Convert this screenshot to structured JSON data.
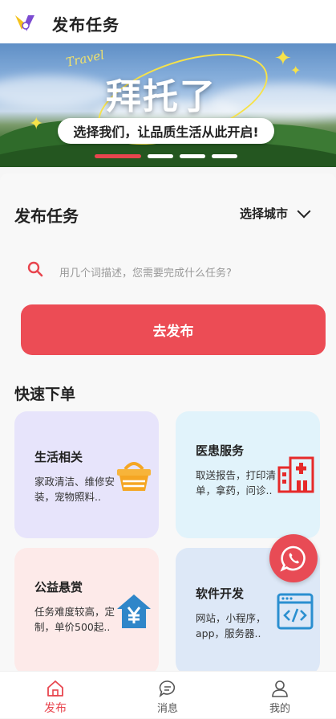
{
  "header": {
    "title": "发布任务"
  },
  "banner": {
    "script_text": "Travel",
    "headline": "拜托了",
    "tagline": "选择我们，让品质生活从此开启!",
    "slides": 4,
    "active_slide": 0
  },
  "publish_section": {
    "title": "发布任务",
    "city_label": "选择城市",
    "search_placeholder": "用几个词描述，您需要完成什么任务?",
    "publish_button": "去发布"
  },
  "quick_order": {
    "title": "快速下单",
    "tiles": [
      {
        "title": "生活相关",
        "desc": "家政清洁、维修安装，宠物照料..",
        "icon": "basket-icon"
      },
      {
        "title": "医患服务",
        "desc": "取送报告，打印清单，拿药，问诊..",
        "icon": "hospital-icon"
      },
      {
        "title": "公益悬赏",
        "desc": "任务难度较高，定制，单价500起..",
        "icon": "house-yen-icon"
      },
      {
        "title": "软件开发",
        "desc": "网站，小程序，app，服务器..",
        "icon": "code-window-icon"
      }
    ]
  },
  "tabbar": {
    "items": [
      {
        "label": "发布",
        "icon": "home-icon",
        "active": true
      },
      {
        "label": "消息",
        "icon": "chat-icon",
        "active": false
      },
      {
        "label": "我的",
        "icon": "user-icon",
        "active": false
      }
    ]
  },
  "colors": {
    "accent": "#ec4c55",
    "floating_button": "#e84b55"
  }
}
